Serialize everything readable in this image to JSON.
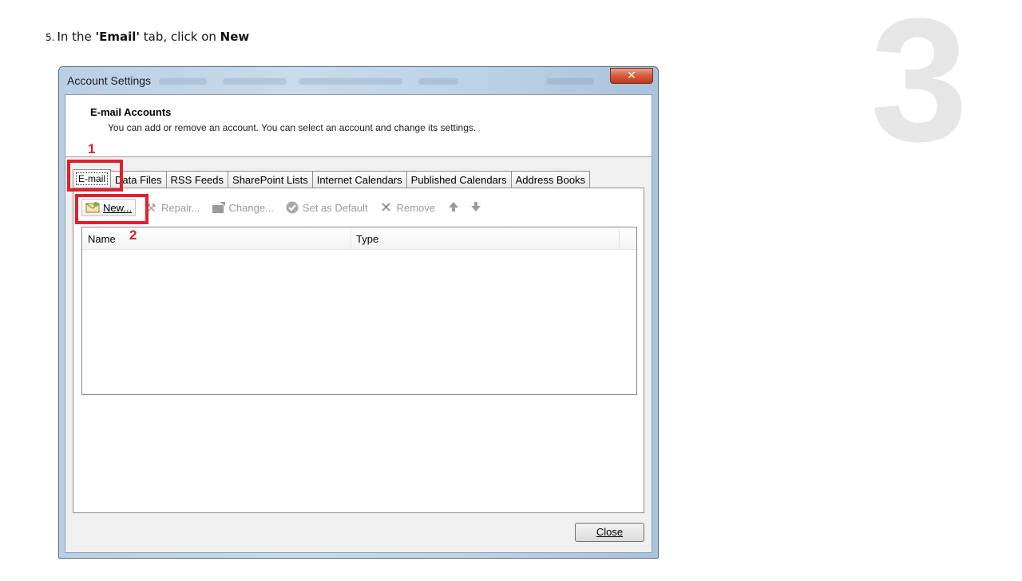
{
  "instruction": {
    "step": "5.",
    "text_before": "In the ",
    "tab_name": "'Email'",
    "text_middle": " tab, click on ",
    "action": "New"
  },
  "step_badge": "3",
  "window": {
    "title": "Account Settings",
    "close_glyph": "✕",
    "header_title": "E-mail Accounts",
    "header_description": "You can add or remove an account. You can select an account and change its settings."
  },
  "tabs": [
    {
      "label": "E-mail",
      "active": true
    },
    {
      "label": "Data Files",
      "active": false
    },
    {
      "label": "RSS Feeds",
      "active": false
    },
    {
      "label": "SharePoint Lists",
      "active": false
    },
    {
      "label": "Internet Calendars",
      "active": false
    },
    {
      "label": "Published Calendars",
      "active": false
    },
    {
      "label": "Address Books",
      "active": false
    }
  ],
  "toolbar": {
    "new_label": "New...",
    "repair_label": "Repair...",
    "change_label": "Change...",
    "set_default_label": "Set as Default",
    "remove_label": "Remove"
  },
  "list": {
    "columns": [
      "Name",
      "Type"
    ]
  },
  "footer": {
    "close_label": "Close"
  },
  "annotations": {
    "label_1": "1",
    "label_2": "2",
    "highlight_color": "#e0202a"
  },
  "colors": {
    "window_frame": "#b9cfe3",
    "annotation_red": "#d8222a"
  }
}
